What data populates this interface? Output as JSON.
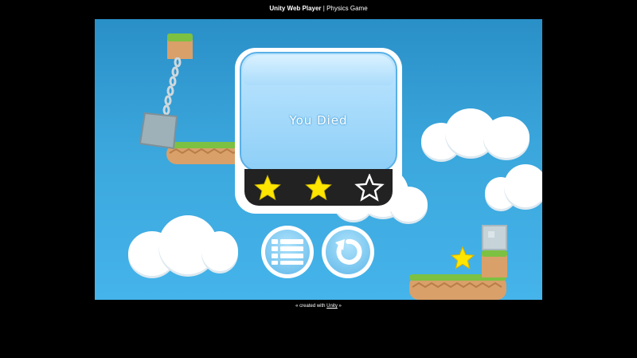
{
  "window": {
    "title_bold": "Unity Web Player",
    "title_sep": " | ",
    "title_rest": "Physics Game"
  },
  "dialog": {
    "message": "You Died",
    "stars_earned": 2,
    "stars_total": 3,
    "star_colors": {
      "filled": "#ffe600",
      "empty": "#ffffff"
    }
  },
  "buttons": {
    "menu": {
      "icon": "list-menu-icon"
    },
    "restart": {
      "icon": "restart-arrow-icon"
    }
  },
  "footer": {
    "prefix": "« created with ",
    "link": "Unity",
    "suffix": " »"
  },
  "colors": {
    "sky": "#3aa6dc",
    "grass": "#7cc142",
    "dirt": "#d9a06a",
    "button_blue": "#5fb8ea"
  }
}
